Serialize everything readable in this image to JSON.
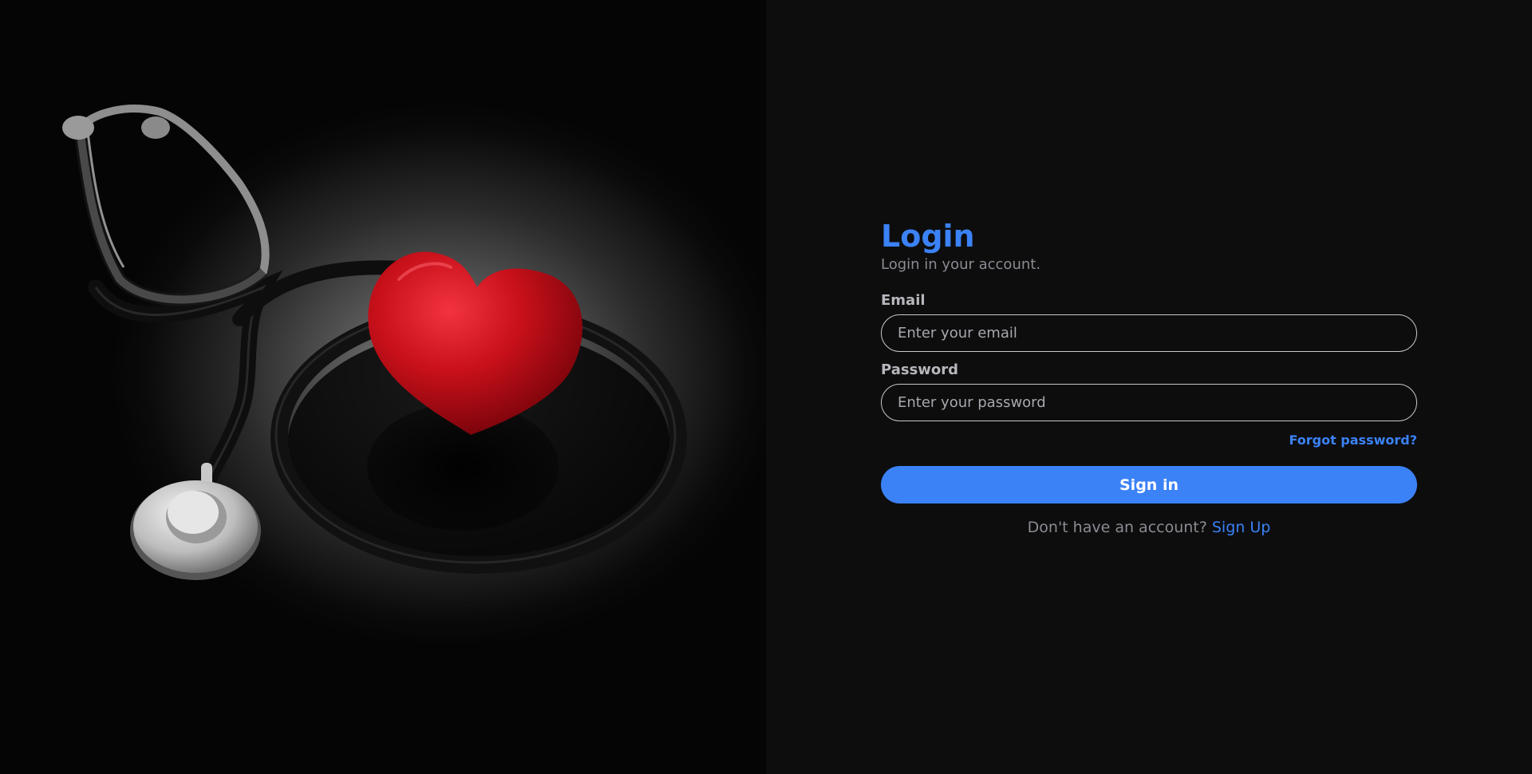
{
  "hero": {
    "image": "stethoscope-with-red-heart"
  },
  "login": {
    "title": "Login",
    "subtitle": "Login in your account.",
    "email_label": "Email",
    "email_placeholder": "Enter your email",
    "email_value": "",
    "password_label": "Password",
    "password_placeholder": "Enter your password",
    "password_value": "",
    "forgot_label": "Forgot password?",
    "signin_label": "Sign in",
    "signup_prompt": "Don't have an account?",
    "signup_label": "Sign Up"
  },
  "colors": {
    "accent": "#3b82f6",
    "background": "#0d0d0e",
    "heart": "#c8101a"
  }
}
